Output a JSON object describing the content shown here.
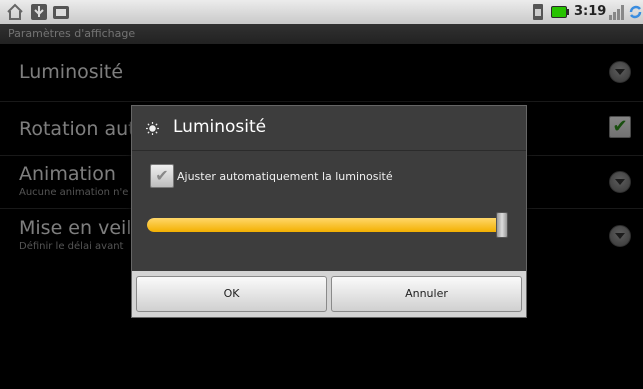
{
  "status_bar": {
    "time": "3:19",
    "icons_left": [
      "home-icon",
      "usb-icon",
      "screenshot-icon"
    ],
    "icons_right": [
      "sim-icon",
      "battery-icon",
      "signal-icon",
      "sync-icon"
    ],
    "battery_color": "#27c200"
  },
  "app": {
    "title": "Paramètres d'affichage"
  },
  "settings": [
    {
      "title": "Luminosité",
      "subtitle": "",
      "control": "chevron-down-icon"
    },
    {
      "title": "Rotation auto",
      "subtitle": "",
      "control": "checkbox-checked",
      "checked": true
    },
    {
      "title": "Animation",
      "subtitle": "Aucune animation n'e",
      "control": "chevron-down-icon"
    },
    {
      "title": "Mise en veille",
      "subtitle": "Définir le délai avant",
      "control": "chevron-down-icon"
    }
  ],
  "dialog": {
    "title": "Luminosité",
    "icon": "brightness-icon",
    "auto_brightness_label": "Ajuster automatiquement la luminosité",
    "auto_brightness_checked": true,
    "brightness_level": 0.99,
    "accent_color": "#f3b000",
    "ok_label": "OK",
    "cancel_label": "Annuler"
  }
}
